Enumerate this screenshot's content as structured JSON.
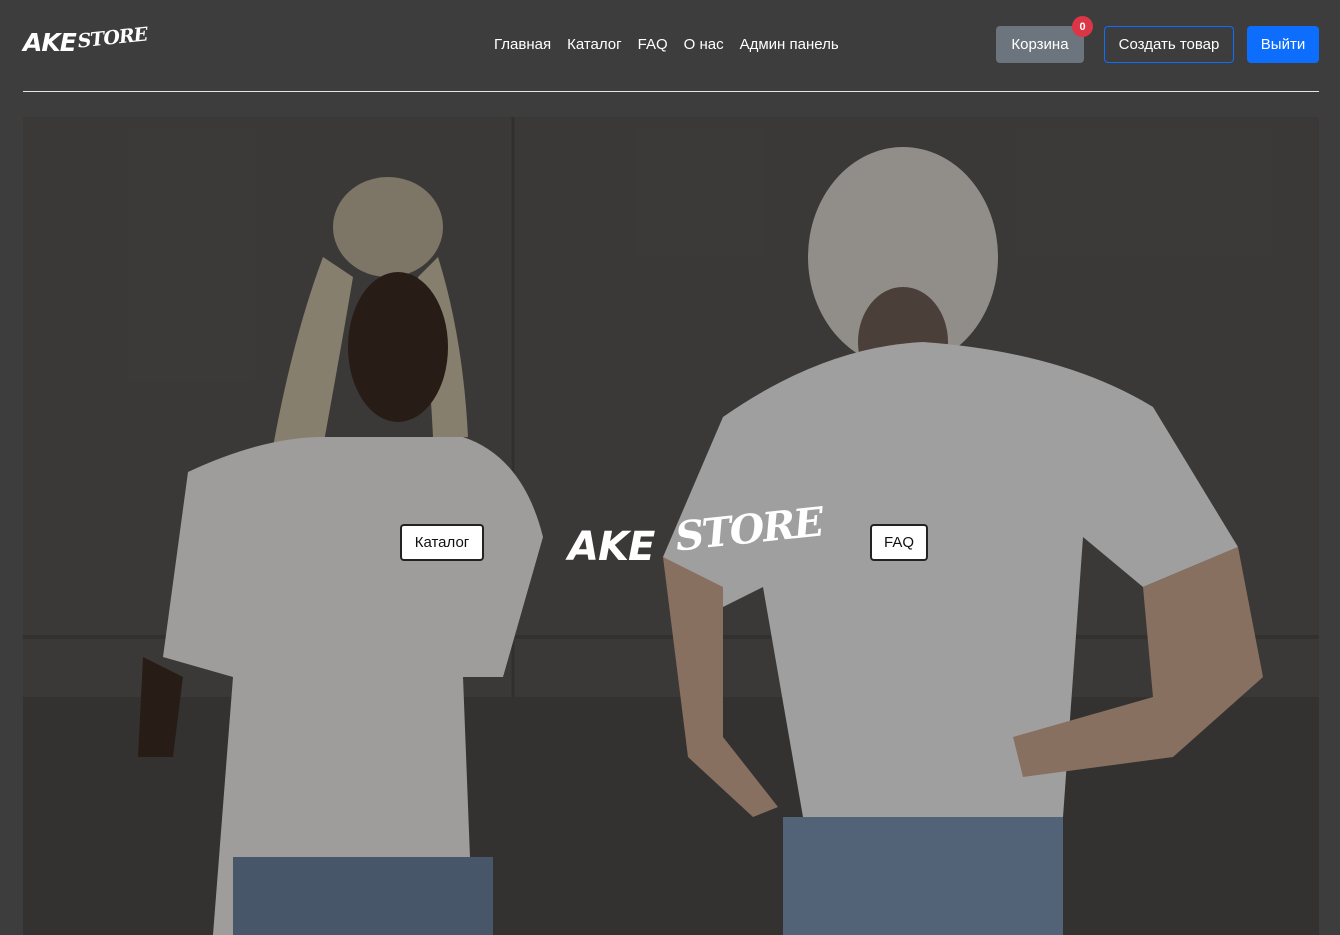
{
  "header": {
    "logo": {
      "ake": "AKE",
      "store": "STORE"
    },
    "nav": [
      {
        "label": "Главная"
      },
      {
        "label": "Каталог"
      },
      {
        "label": "FAQ"
      },
      {
        "label": "О нас"
      },
      {
        "label": "Админ панель"
      }
    ],
    "cart_label": "Корзина",
    "cart_count": "0",
    "create_label": "Создать товар",
    "logout_label": "Выйти"
  },
  "hero": {
    "catalog_label": "Каталог",
    "faq_label": "FAQ",
    "logo": {
      "ake": "AKE",
      "store": "STORE"
    },
    "image_description": "photo-two-people-white-tshirts-concrete-wall"
  },
  "colors": {
    "background": "#3d3d3d",
    "primary": "#0d6efd",
    "secondary": "#6c757d",
    "danger": "#dc3545"
  }
}
